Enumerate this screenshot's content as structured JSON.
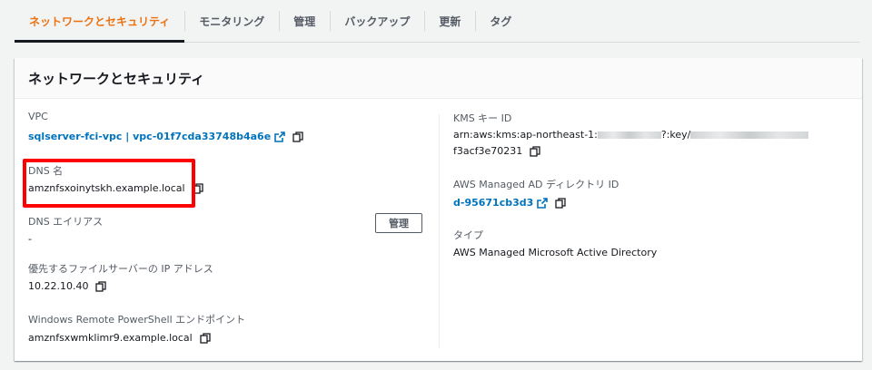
{
  "tabs": [
    {
      "label": "ネットワークとセキュリティ",
      "active": true
    },
    {
      "label": "モニタリング"
    },
    {
      "label": "管理"
    },
    {
      "label": "バックアップ"
    },
    {
      "label": "更新"
    },
    {
      "label": "タグ"
    }
  ],
  "panel": {
    "title": "ネットワークとセキュリティ",
    "manage_button": "管理"
  },
  "left": {
    "vpc": {
      "label": "VPC",
      "value": "sqlserver-fci-vpc | vpc-01f7cda33748b4a6e"
    },
    "dns_name": {
      "label": "DNS 名",
      "value": "amznfsxoinytskh.example.local"
    },
    "dns_alias": {
      "label": "DNS エイリアス",
      "value": "-"
    },
    "preferred_ip": {
      "label": "優先するファイルサーバーの IP アドレス",
      "value": "10.22.10.40"
    },
    "powershell": {
      "label": "Windows Remote PowerShell エンドポイント",
      "value": "amznfsxwmklimr9.example.local"
    }
  },
  "right": {
    "kms": {
      "label": "KMS キー ID",
      "prefix": "arn:aws:kms:ap-northeast-1:",
      "middle": "?:key/",
      "suffix": "f3acf3e70231"
    },
    "ad": {
      "label": "AWS Managed AD ディレクトリ ID",
      "value": "d-95671cb3d3"
    },
    "type": {
      "label": "タイプ",
      "value": "AWS Managed Microsoft Active Directory"
    }
  },
  "colors": {
    "accent": "#ec7211",
    "link": "#0073bb",
    "highlight": "#ff0000"
  },
  "icons": [
    "copy-icon",
    "external-link-icon"
  ]
}
